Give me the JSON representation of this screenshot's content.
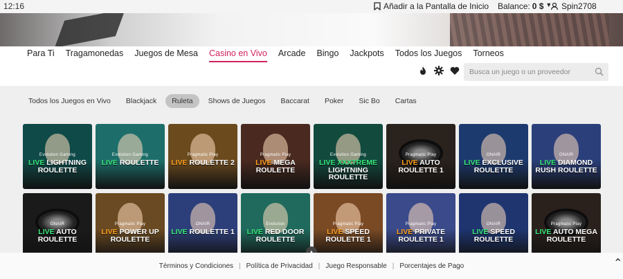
{
  "status": {
    "time": "12:16"
  },
  "header": {
    "add_home_label": "Añadir a la Pantalla de Inicio",
    "balance_label": "Balance:",
    "balance_value": "0 $",
    "username": "Spin2708"
  },
  "banner": {
    "active_dot_index": 1,
    "dot_count": 4
  },
  "nav": {
    "items": [
      "Para Ti",
      "Tragamonedas",
      "Juegos de Mesa",
      "Casino en Vivo",
      "Arcade",
      "Bingo",
      "Jackpots",
      "Todos los Juegos",
      "Torneos"
    ],
    "active_index": 3
  },
  "tools": {
    "icons": [
      "flame-icon",
      "settings-star-icon",
      "heart-icon"
    ]
  },
  "search": {
    "placeholder": "Busca un juego o un proveedor"
  },
  "subnav": {
    "items": [
      "Todos los Juegos en Vivo",
      "Blackjack",
      "Ruleta",
      "Shows de Juegos",
      "Baccarat",
      "Poker",
      "Sic Bo",
      "Cartas"
    ],
    "active_index": 2
  },
  "games": [
    {
      "brand": "Evolution Gaming",
      "live": "LIVE",
      "name": "LIGHTNING ROULETTE",
      "bg": "#0f4a48",
      "kind": "person",
      "live_color": "green"
    },
    {
      "brand": "Evolution Gaming",
      "live": "LIVE",
      "name": "ROULETTE",
      "bg": "#1d6e6a",
      "kind": "person",
      "live_color": "green"
    },
    {
      "brand": "Pragmatic Play",
      "live": "LIVE",
      "name": "ROULETTE 2",
      "bg": "#6b4a1e",
      "kind": "person",
      "live_color": "orange"
    },
    {
      "brand": "Pragmatic Play",
      "live": "LIVE",
      "name": "MEGA ROULETTE",
      "bg": "#4a2a20",
      "kind": "person",
      "live_color": "orange"
    },
    {
      "brand": "Evolution Gaming",
      "live": "LIVE XXXTREME",
      "name": "LIGHTNING ROULETTE",
      "bg": "#124a3e",
      "kind": "person",
      "live_color": "green"
    },
    {
      "brand": "Pragmatic Play",
      "live": "LIVE",
      "name": "AUTO ROULETTE 1",
      "bg": "#2a221c",
      "kind": "wheel",
      "live_color": "orange"
    },
    {
      "brand": "ONAIR",
      "live": "LIVE",
      "name": "EXCLUSIVE ROULETTE",
      "bg": "#1d3a6e",
      "kind": "person",
      "live_color": "green"
    },
    {
      "brand": "ONAIR",
      "live": "LIVE",
      "name": "DIAMOND RUSH ROULETTE",
      "bg": "#2b3f7a",
      "kind": "person",
      "live_color": "green"
    },
    {
      "brand": "ONAIR",
      "live": "LIVE",
      "name": "AUTO ROULETTE",
      "bg": "#1a1a1a",
      "kind": "wheel",
      "live_color": "green"
    },
    {
      "brand": "Pragmatic Play",
      "live": "LIVE",
      "name": "POWER UP ROULETTE",
      "bg": "#6a4a22",
      "kind": "person",
      "live_color": "orange"
    },
    {
      "brand": "ONAIR",
      "live": "LIVE",
      "name": "ROULETTE 1",
      "bg": "#2d3f7a",
      "kind": "person",
      "live_color": "green"
    },
    {
      "brand": "Evolution",
      "live": "LIVE",
      "name": "RED DOOR ROULETTE",
      "bg": "#1f6a5c",
      "kind": "person",
      "live_color": "green"
    },
    {
      "brand": "Pragmatic Play",
      "live": "LIVE",
      "name": "SPEED ROULETTE 1",
      "bg": "#7a4a24",
      "kind": "person",
      "live_color": "orange"
    },
    {
      "brand": "Pragmatic Play",
      "live": "LIVE",
      "name": "PRIVATE ROULETTE 1",
      "bg": "#3a4a8a",
      "kind": "person",
      "live_color": "orange"
    },
    {
      "brand": "ONAIR",
      "live": "LIVE",
      "name": "SPEED ROULETTE",
      "bg": "#1e3570",
      "kind": "person",
      "live_color": "green"
    },
    {
      "brand": "Pragmatic Play",
      "live": "LIVE",
      "name": "AUTO MEGA ROULETTE",
      "bg": "#2b211c",
      "kind": "wheel",
      "live_color": "green"
    }
  ],
  "footer": {
    "links": [
      "Términos y Condiciones",
      "Política de Privacidad",
      "Juego Responsable",
      "Porcentajes de Pago"
    ]
  }
}
